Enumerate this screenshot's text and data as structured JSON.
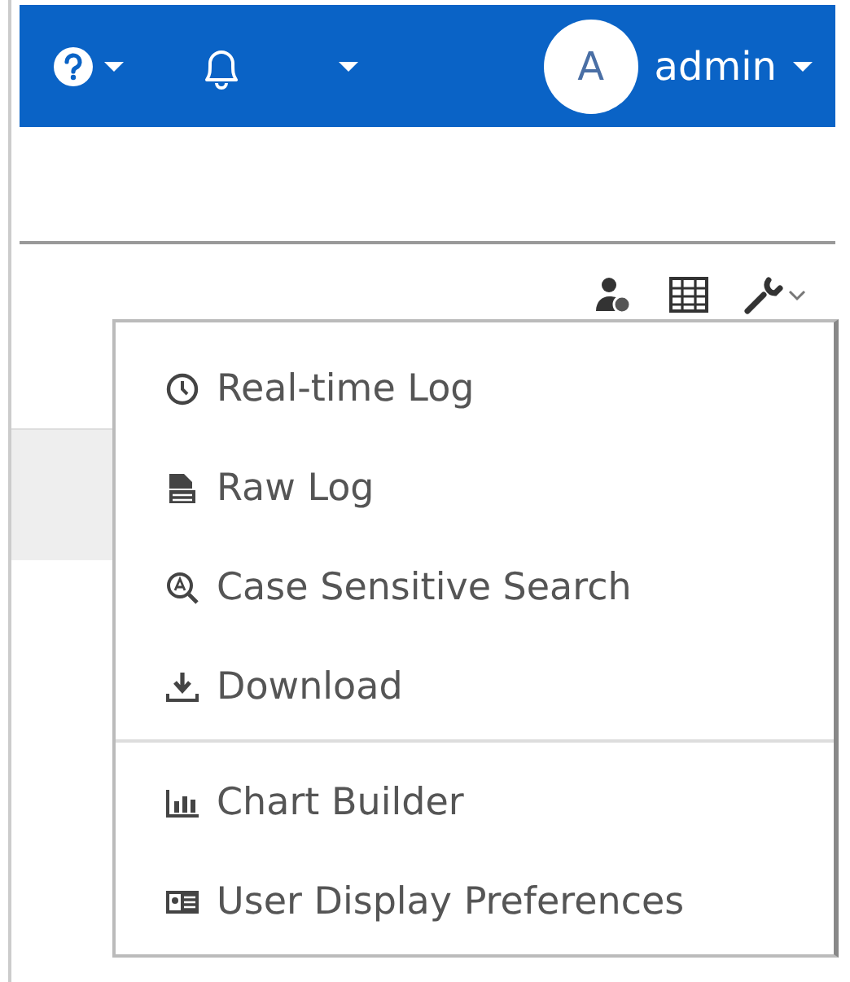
{
  "header": {
    "user": {
      "avatar": "A",
      "name": "admin"
    }
  },
  "menu": {
    "groups": [
      [
        {
          "label": "Real-time Log",
          "kind": "clock"
        },
        {
          "label": "Raw Log",
          "kind": "document"
        },
        {
          "label": "Case Sensitive Search",
          "kind": "search"
        },
        {
          "label": "Download",
          "kind": "download"
        }
      ],
      [
        {
          "label": "Chart Builder",
          "kind": "chart"
        },
        {
          "label": "User Display Preferences",
          "kind": "card"
        }
      ]
    ]
  }
}
